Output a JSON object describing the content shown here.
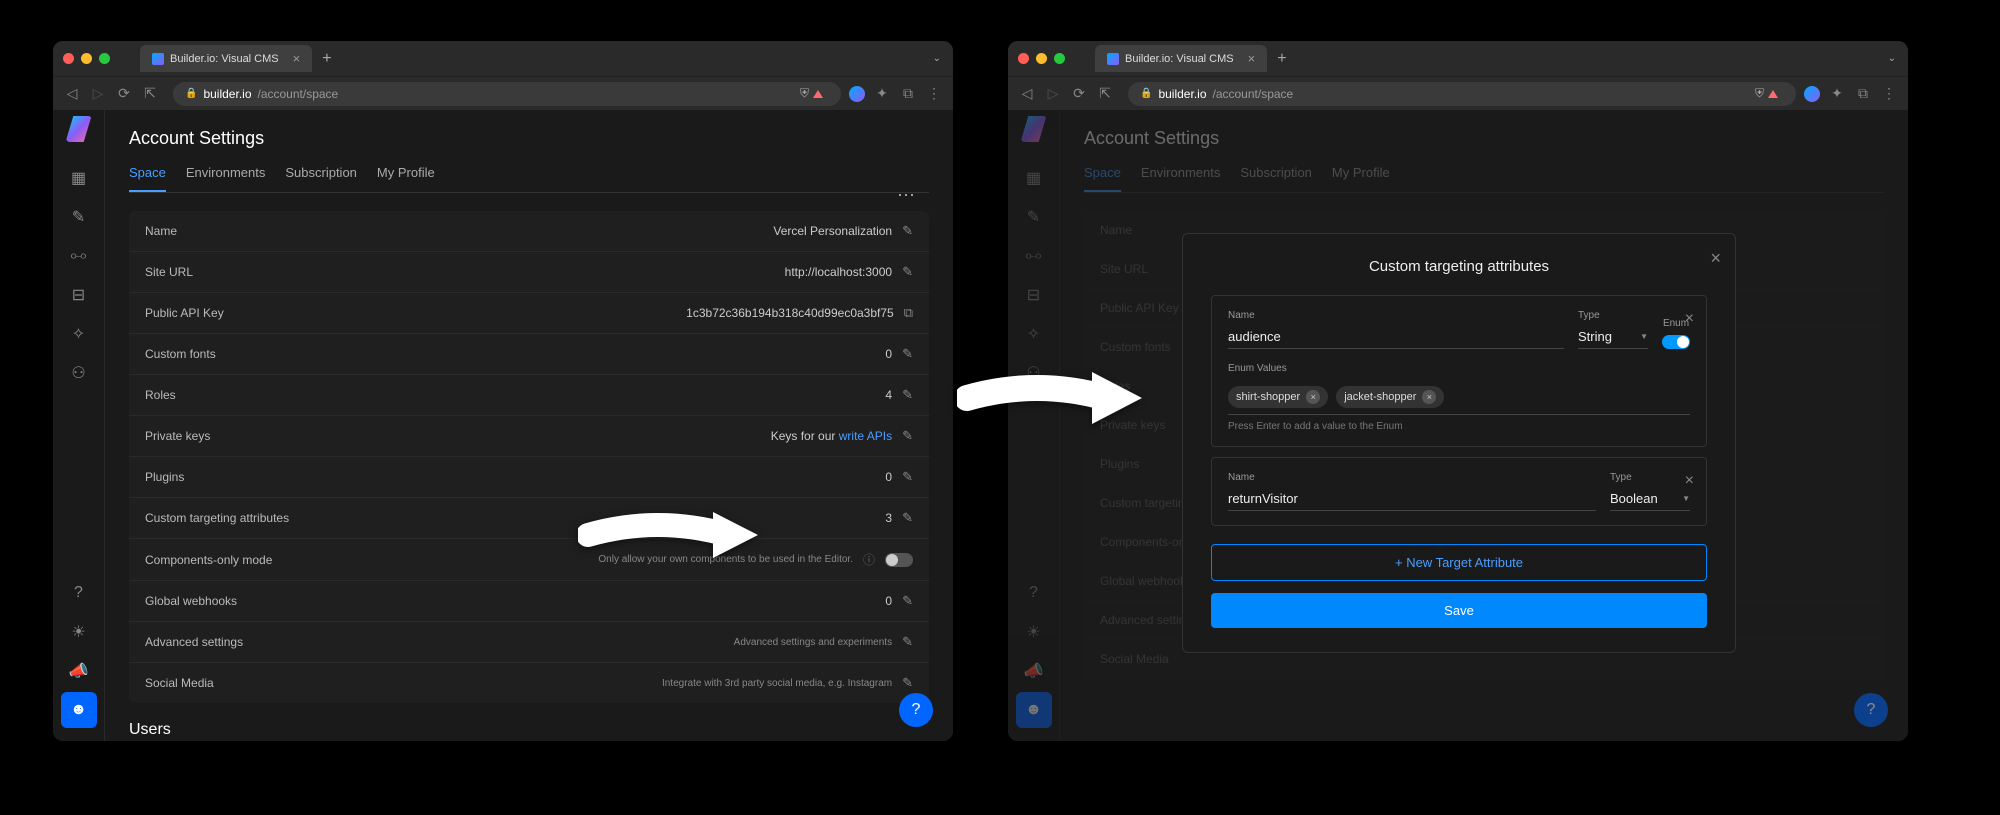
{
  "browser": {
    "tab_title": "Builder.io: Visual CMS",
    "url_domain": "builder.io",
    "url_path": "/account/space"
  },
  "page": {
    "title": "Account Settings",
    "tabs": [
      "Space",
      "Environments",
      "Subscription",
      "My Profile"
    ],
    "users_heading": "Users"
  },
  "rows": {
    "name": {
      "label": "Name",
      "value": "Vercel Personalization"
    },
    "site_url": {
      "label": "Site URL",
      "value": "http://localhost:3000"
    },
    "api_key": {
      "label": "Public API Key",
      "value": "1c3b72c36b194b318c40d99ec0a3bf75"
    },
    "custom_fonts": {
      "label": "Custom fonts",
      "value": "0"
    },
    "roles": {
      "label": "Roles",
      "value": "4"
    },
    "private_keys": {
      "label": "Private keys",
      "prefix": "Keys for our ",
      "link": "write APIs"
    },
    "plugins": {
      "label": "Plugins",
      "value": "0"
    },
    "cta": {
      "label": "Custom targeting attributes",
      "value": "3"
    },
    "comp_only": {
      "label": "Components-only mode",
      "hint": "Only allow your own components to be used in the Editor."
    },
    "webhooks": {
      "label": "Global webhooks",
      "value": "0"
    },
    "advanced": {
      "label": "Advanced settings",
      "value": "Advanced settings and experiments"
    },
    "social": {
      "label": "Social Media",
      "value": "Integrate with 3rd party social media, e.g. Instagram"
    }
  },
  "modal": {
    "title": "Custom targeting attributes",
    "name_label": "Name",
    "type_label": "Type",
    "enum_label": "Enum",
    "enum_values_label": "Enum Values",
    "attr1_name": "audience",
    "attr1_type": "String",
    "chips": [
      "shirt-shopper",
      "jacket-shopper"
    ],
    "chips_hint": "Press Enter to add a value to the Enum",
    "attr2_name": "returnVisitor",
    "attr2_type": "Boolean",
    "new_btn": "+ New Target Attribute",
    "save_btn": "Save"
  }
}
